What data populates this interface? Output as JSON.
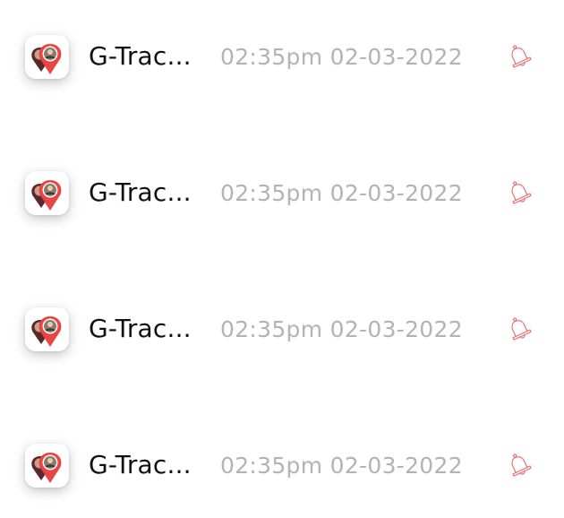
{
  "notifications": [
    {
      "app_name": "G-Trac...",
      "time": "02:35pm",
      "date": "02-03-2022",
      "app_icon": "map-pin-avatar-icon",
      "action_icon": "bell-icon"
    },
    {
      "app_name": "G-Trac...",
      "time": "02:35pm",
      "date": "02-03-2022",
      "app_icon": "map-pin-avatar-icon",
      "action_icon": "bell-icon"
    },
    {
      "app_name": "G-Trac...",
      "time": "02:35pm",
      "date": "02-03-2022",
      "app_icon": "map-pin-avatar-icon",
      "action_icon": "bell-icon"
    },
    {
      "app_name": "G-Trac...",
      "time": "02:35pm",
      "date": "02-03-2022",
      "app_icon": "map-pin-avatar-icon",
      "action_icon": "bell-icon"
    }
  ],
  "colors": {
    "bell": "#e86a6a",
    "pin_red": "#e84545",
    "pin_dark": "#5a2a2a",
    "timestamp": "#b3b3b3",
    "app_name": "#111111"
  }
}
